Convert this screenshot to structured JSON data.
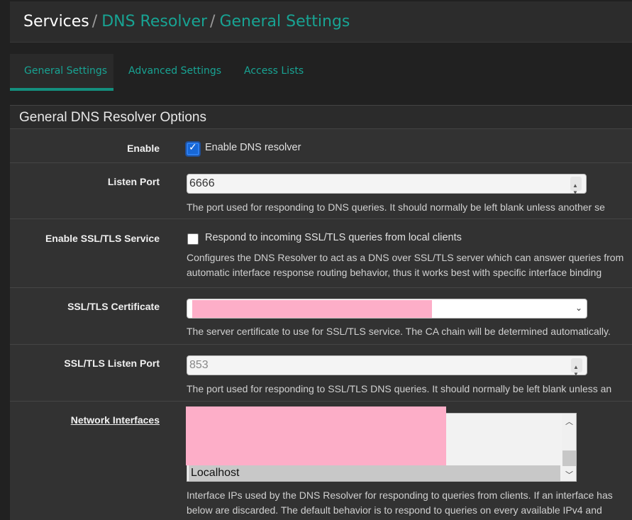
{
  "breadcrumb": {
    "root": "Services",
    "sep1": "/",
    "item1": "DNS Resolver",
    "sep2": "/",
    "item2": "General Settings"
  },
  "tabs": [
    {
      "label": "General Settings",
      "active": true
    },
    {
      "label": "Advanced Settings",
      "active": false
    },
    {
      "label": "Access Lists",
      "active": false
    }
  ],
  "panel": {
    "title": "General DNS Resolver Options"
  },
  "enable": {
    "label": "Enable",
    "checkbox_label": "Enable DNS resolver",
    "checked": true
  },
  "listen_port": {
    "label": "Listen Port",
    "value": "6666",
    "help": "The port used for responding to DNS queries. It should normally be left blank unless another se"
  },
  "ssl_service": {
    "label": "Enable SSL/TLS Service",
    "checkbox_label": "Respond to incoming SSL/TLS queries from local clients",
    "checked": false,
    "help_line1": "Configures the DNS Resolver to act as a DNS over SSL/TLS server which can answer queries from",
    "help_line2": "automatic interface response routing behavior, thus it works best with specific interface binding"
  },
  "ssl_cert": {
    "label": "SSL/TLS Certificate",
    "help": "The server certificate to use for SSL/TLS service. The CA chain will be determined automatically."
  },
  "ssl_port": {
    "label": "SSL/TLS Listen Port",
    "placeholder": "853",
    "help": "The port used for responding to SSL/TLS DNS queries. It should normally be left blank unless an"
  },
  "network_interfaces": {
    "label": "Network Interfaces",
    "items": [
      "Localhost"
    ],
    "help_line1": "Interface IPs used by the DNS Resolver for responding to queries from clients. If an interface has",
    "help_line2": "below are discarded. The default behavior is to respond to queries on every available IPv4 and"
  },
  "colors": {
    "accent": "#18a393",
    "checkbox_checked": "#1767d6",
    "redaction": "#fdaec8"
  },
  "icons": [
    "chevron-down-icon",
    "spinner-arrows-icon",
    "check-icon",
    "chevron-up-icon"
  ]
}
